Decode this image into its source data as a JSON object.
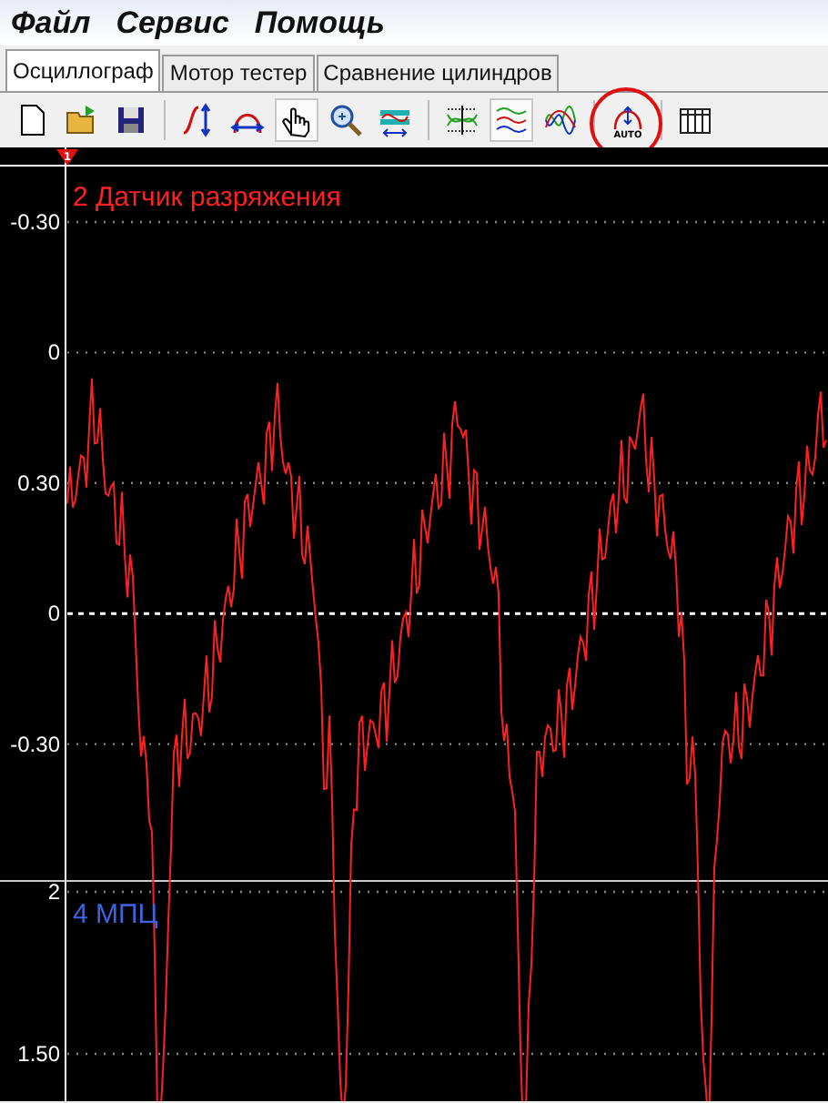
{
  "menu": [
    {
      "label": "Файл"
    },
    {
      "label": "Сервис"
    },
    {
      "label": "Помощь"
    }
  ],
  "tabs": [
    {
      "label": "Осциллограф",
      "selected": true
    },
    {
      "label": "Мотор тестер",
      "selected": false
    },
    {
      "label": "Сравнение цилиндров",
      "selected": false
    }
  ],
  "toolbar": [
    {
      "kind": "new",
      "pressed": false
    },
    {
      "kind": "open",
      "pressed": false
    },
    {
      "kind": "save",
      "pressed": false
    },
    {
      "kind": "separator"
    },
    {
      "kind": "vscale",
      "pressed": false
    },
    {
      "kind": "hscale",
      "pressed": false
    },
    {
      "kind": "hand",
      "pressed": true
    },
    {
      "kind": "zoom",
      "pressed": false
    },
    {
      "kind": "fit",
      "pressed": false
    },
    {
      "kind": "separator"
    },
    {
      "kind": "cross",
      "pressed": false
    },
    {
      "kind": "stack",
      "pressed": true
    },
    {
      "kind": "overlay",
      "pressed": false
    },
    {
      "kind": "separator"
    },
    {
      "kind": "auto",
      "pressed": false,
      "label": "AUTO",
      "highlighted": true
    },
    {
      "kind": "separator"
    },
    {
      "kind": "table",
      "pressed": false
    }
  ],
  "scope": {
    "marker": "1",
    "channels": [
      {
        "name": "2 Датчик разряжения",
        "color": "#ff2020",
        "ticks": [
          {
            "label": "-0.30",
            "zero": false
          },
          {
            "label": "0",
            "zero": false
          },
          {
            "label": "0.30",
            "zero": false
          },
          {
            "label": "0",
            "zero": true
          },
          {
            "label": "-0.30",
            "zero": false
          }
        ]
      },
      {
        "name": "4 МПЦ",
        "color": "#3a66e0",
        "ticks": [
          {
            "label": "2",
            "zero": false
          },
          {
            "label": "1.50",
            "zero": false
          }
        ]
      }
    ]
  }
}
